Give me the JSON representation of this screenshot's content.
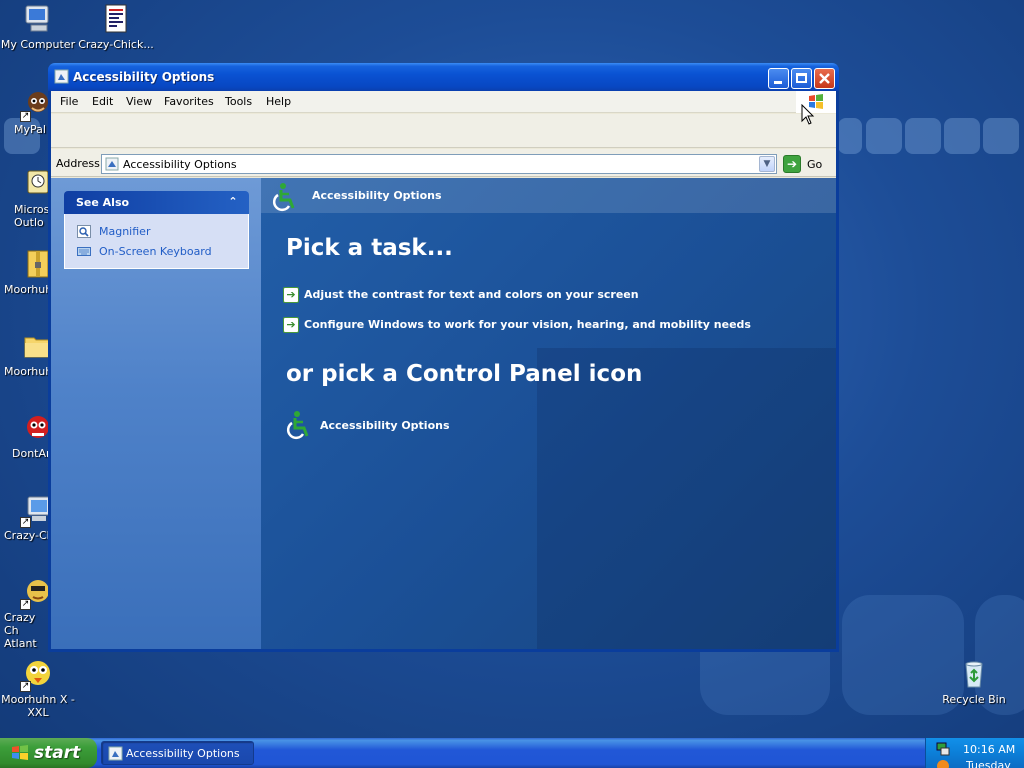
{
  "desktop": {
    "icons": [
      {
        "label": "My Computer",
        "icon": "my-computer-icon"
      },
      {
        "label": "Crazy-Chick...",
        "icon": "document-icon"
      },
      {
        "label": "MyPal",
        "icon": "mypal-icon"
      },
      {
        "label": "Micros Outlo",
        "icon": "outlook-icon"
      },
      {
        "label": "Moorhuh",
        "icon": "zip-archive-icon"
      },
      {
        "label": "Moorhuh",
        "icon": "folder-icon"
      },
      {
        "label": "DontAr",
        "icon": "dontar-icon"
      },
      {
        "label": "Crazy-Ch",
        "icon": "crazy-chicken-icon"
      },
      {
        "label": "Crazy Ch Atlant",
        "icon": "crazy-chicken-atlantis-icon"
      },
      {
        "label": "Moorhuhn X - XXL",
        "icon": "moorhuhn-xxl-icon"
      },
      {
        "label": "Recycle Bin",
        "icon": "recycle-bin-icon"
      }
    ]
  },
  "window": {
    "title": "Accessibility Options",
    "menu": [
      "File",
      "Edit",
      "View",
      "Favorites",
      "Tools",
      "Help"
    ],
    "address": {
      "label": "Address",
      "value": "Accessibility Options",
      "go_label": "Go"
    },
    "see_also": {
      "title": "See Also",
      "links": [
        "Magnifier",
        "On-Screen Keyboard"
      ]
    },
    "content": {
      "header_title": "Accessibility Options",
      "pick_task": "Pick a task...",
      "tasks": [
        "Adjust the contrast for text and colors on your screen",
        "Configure Windows to work for your vision, hearing, and mobility needs"
      ],
      "pick_icon": "or pick a Control Panel icon",
      "icons": [
        "Accessibility Options"
      ]
    }
  },
  "taskbar": {
    "start_label": "start",
    "tasks": [
      "Accessibility Options"
    ],
    "clock": "10:16 AM",
    "day": "Tuesday"
  },
  "colors": {
    "desktop_bg": "#1d4d97",
    "titlebar": "#0a52d3",
    "start_green": "#3c9e3a",
    "link_blue": "#215dc6"
  }
}
